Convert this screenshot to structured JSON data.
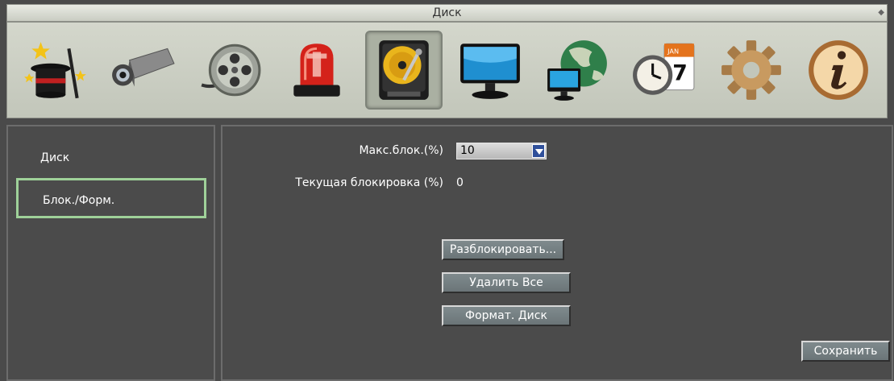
{
  "window": {
    "title": "Диск"
  },
  "toolbar": {
    "icons": [
      {
        "name": "wizard-hat-icon"
      },
      {
        "name": "camera-icon"
      },
      {
        "name": "film-reel-icon"
      },
      {
        "name": "alarm-siren-icon"
      },
      {
        "name": "hard-disk-icon",
        "active": true
      },
      {
        "name": "monitor-icon"
      },
      {
        "name": "network-globe-icon"
      },
      {
        "name": "clock-calendar-icon",
        "calendar_day": "7",
        "calendar_month": "JAN"
      },
      {
        "name": "gear-icon"
      },
      {
        "name": "info-icon"
      }
    ]
  },
  "sidebar": {
    "items": [
      {
        "label": "Диск"
      },
      {
        "label": "Блок./Форм.",
        "selected": true
      }
    ]
  },
  "main": {
    "max_lock_label": "Макс.блок.(%)",
    "max_lock_value": "10",
    "current_lock_label": "Текущая блокировка (%)",
    "current_lock_value": "0",
    "unlock_button": "Разблокировать...",
    "delete_all_button": "Удалить Все",
    "format_disk_button": "Формат. Диск",
    "save_button": "Сохранить"
  },
  "colors": {
    "background": "#4a4a4a",
    "toolbar": "#c9ccc2",
    "selected_border": "#9fd199",
    "dropdown_arrow": "#2f4f9a"
  }
}
